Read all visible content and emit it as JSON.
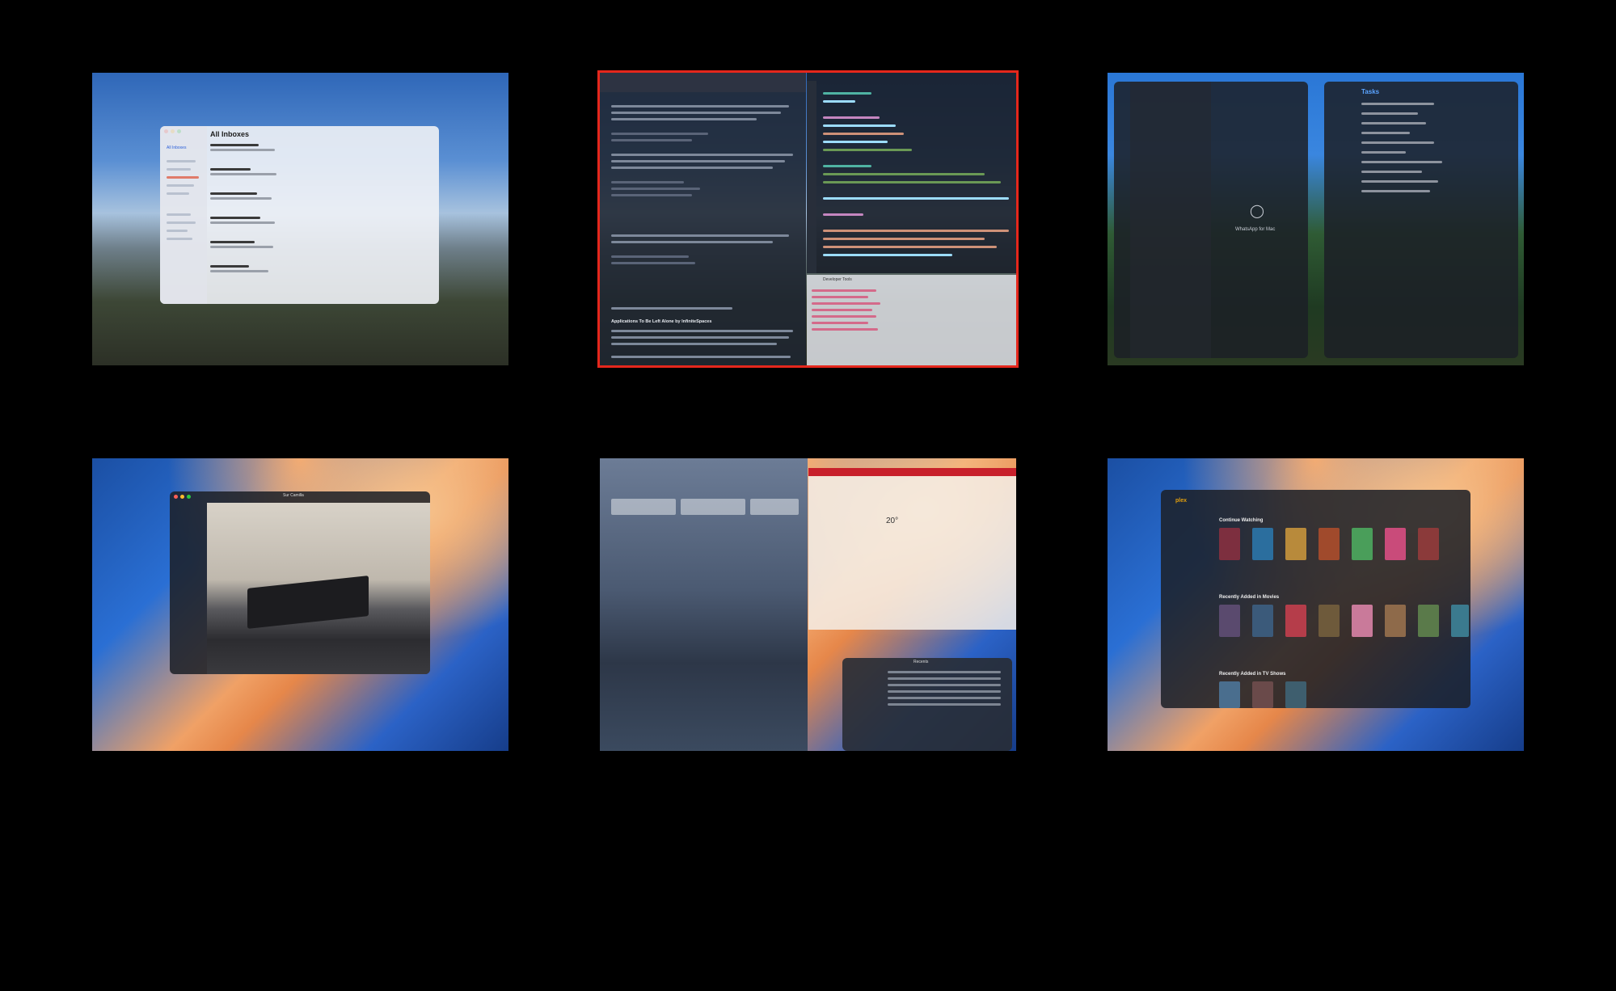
{
  "workspaces": [
    {
      "id": "ws1",
      "selected": false,
      "app": "Mail",
      "title": "All Inboxes",
      "sidebar_item": "All Inboxes"
    },
    {
      "id": "ws2",
      "selected": true,
      "app": "Code Editor",
      "readme_heading": "Applications To Be Left Alone by InfiniteSpaces",
      "panel_title": "Developer Tools"
    },
    {
      "id": "ws3",
      "selected": false,
      "app": "WhatsApp",
      "placeholder_label": "WhatsApp for Mac",
      "reminders_title": "Tasks"
    },
    {
      "id": "ws4",
      "selected": false,
      "app": "Photos",
      "title": "Sur Camilla"
    },
    {
      "id": "ws5",
      "selected": false,
      "app": "Weather and Finder",
      "finder_title": "Recents",
      "temperature": "20°"
    },
    {
      "id": "ws6",
      "selected": false,
      "app": "Plex",
      "brand": "plex",
      "sections": [
        "Continue Watching",
        "Recently Added in Movies",
        "Recently Added in TV Shows"
      ]
    }
  ],
  "colors": {
    "background": "#000000",
    "selection_border": "#e5271c"
  }
}
